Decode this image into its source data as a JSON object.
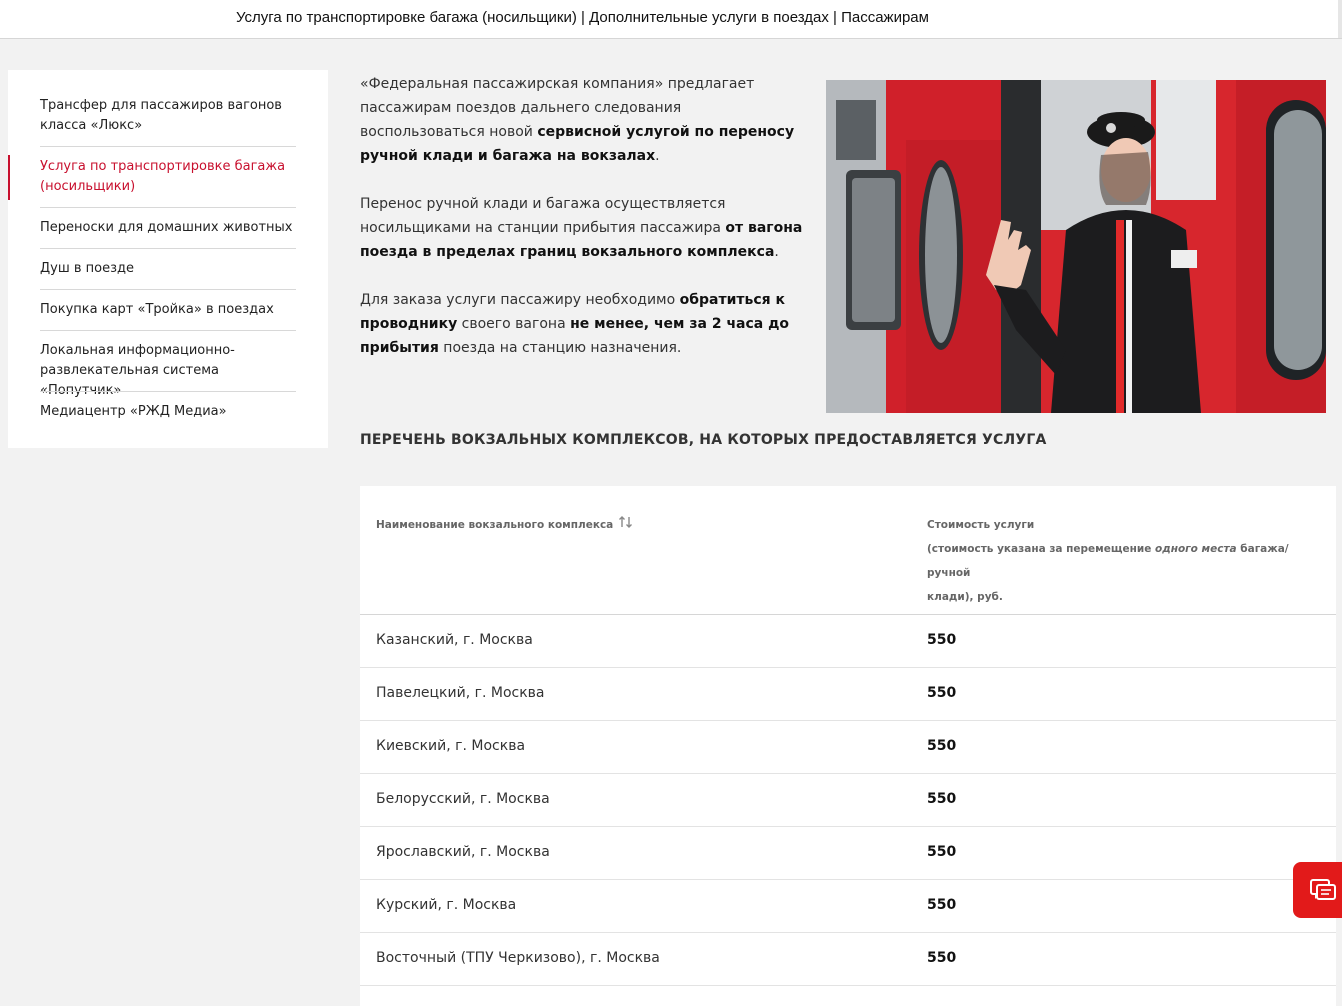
{
  "header": {
    "title": "Услуга по транспортировке багажа (носильщики) | Дополнительные услуги в поездах | Пассажирам"
  },
  "sidebar": {
    "items": [
      {
        "label_1": "Трансфер для пассажиров вагонов",
        "label_2": "класса «Люкс»"
      },
      {
        "label_1": "Услуга по транспортировке багажа",
        "label_2": "(носильщики)",
        "active": true
      },
      {
        "label_1": "Переноски для домашних животных"
      },
      {
        "label_1": "Душ в поезде"
      },
      {
        "label_1": "Покупка карт «Тройка» в поездах"
      },
      {
        "label_1": "Локальная информационно-",
        "label_2": "развлекательная система «Попутчик»"
      },
      {
        "label_1": "Медиацентр «РЖД Медиа»"
      }
    ]
  },
  "intro": {
    "p1_a": "«Федеральная пассажирская компания» предлагает пассажирам поездов дальнего следования воспользоваться новой ",
    "p1_b": "сервисной услугой по переносу ручной клади и багажа на вокзалах",
    "p1_c": ".",
    "p2_a": "Перенос ручной клади и багажа осуществляется носильщиками на станции прибытия пассажира ",
    "p2_b": "от вагона поезда в пределах границ вокзального комплекса",
    "p2_c": ".",
    "p3_a": "Для заказа услуги пассажиру необходимо ",
    "p3_b": "обратиться к проводнику",
    "p3_c": " своего вагона ",
    "p3_d": "не менее, чем за 2 часа до прибытия",
    "p3_e": " поезда на станцию назначения."
  },
  "list_heading": "ПЕРЕЧЕНЬ ВОКЗАЛЬНЫХ КОМПЛЕКСОВ, НА КОТОРЫХ ПРЕДОСТАВЛЯЕТСЯ УСЛУГА",
  "table": {
    "col_name": "Наименование вокзального комплекса",
    "col_price_1": "Стоимость услуги",
    "col_price_2a": "(стоимость указана за перемещение ",
    "col_price_2b": "одного места",
    "col_price_2c": " багажа/ручной",
    "col_price_3": "клади), руб.",
    "rows": [
      {
        "name": "Казанский, г. Москва",
        "price": "550"
      },
      {
        "name": "Павелецкий, г. Москва",
        "price": "550"
      },
      {
        "name": "Киевский, г. Москва",
        "price": "550"
      },
      {
        "name": "Белорусский, г. Москва",
        "price": "550"
      },
      {
        "name": "Ярославский, г. Москва",
        "price": "550"
      },
      {
        "name": "Курский, г. Москва",
        "price": "550"
      },
      {
        "name": "Восточный (ТПУ Черкизово), г. Москва",
        "price": "550"
      }
    ]
  },
  "colors": {
    "accent": "#c8102e",
    "chat_button": "#e21a1a",
    "background": "#f2f2f2"
  },
  "icons": {
    "sort": "sort-arrows-icon",
    "chat": "chat-bubbles-icon"
  }
}
